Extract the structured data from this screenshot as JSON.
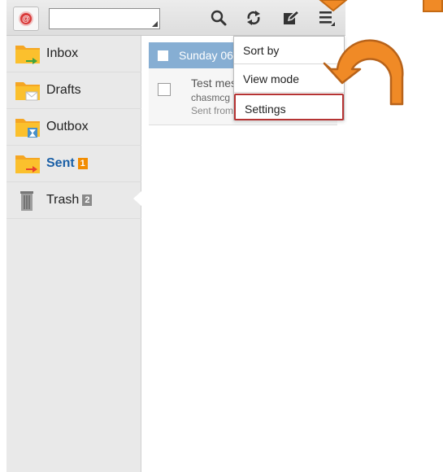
{
  "topbar": {
    "account_icon": "email-account-icon",
    "account_select_value": "",
    "icons": [
      "search-icon",
      "sync-icon",
      "compose-icon",
      "overflow-menu-icon"
    ]
  },
  "sidebar": {
    "items": [
      {
        "label": "Inbox",
        "icon": "inbox-folder-icon",
        "badge": ""
      },
      {
        "label": "Drafts",
        "icon": "drafts-folder-icon",
        "badge": ""
      },
      {
        "label": "Outbox",
        "icon": "outbox-folder-icon",
        "badge": ""
      },
      {
        "label": "Sent",
        "icon": "sent-folder-icon",
        "badge": "1",
        "active": true
      },
      {
        "label": "Trash",
        "icon": "trash-icon",
        "badge": "2"
      }
    ]
  },
  "list": {
    "date_header": "Sunday 06",
    "message": {
      "subject": "Test mes",
      "sender": "chasmcg",
      "preview": "Sent from"
    }
  },
  "menu": {
    "items": [
      "Sort by",
      "View mode",
      "Settings"
    ],
    "highlighted": "Settings"
  },
  "colors": {
    "accent_orange": "#f08a26",
    "highlight_border": "#b53333",
    "date_header_bg": "#86aed3",
    "sent_label": "#1a5fa6"
  }
}
